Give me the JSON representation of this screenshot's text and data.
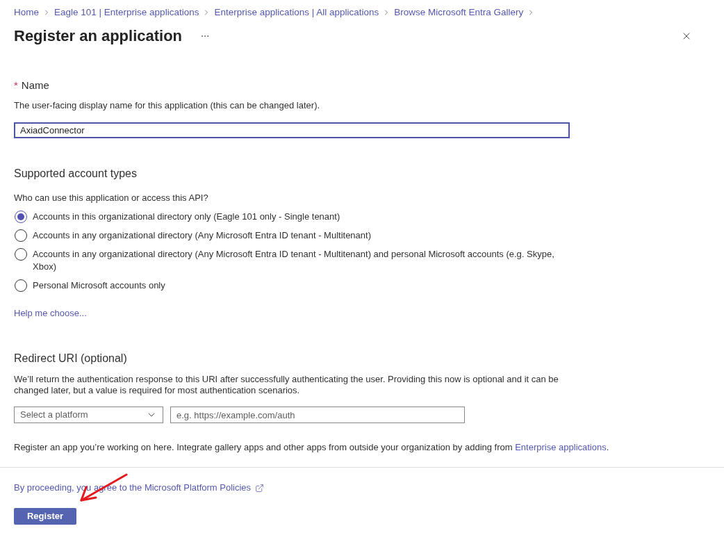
{
  "breadcrumb": [
    {
      "label": "Home"
    },
    {
      "label": "Eagle 101 | Enterprise applications"
    },
    {
      "label": "Enterprise applications | All applications"
    },
    {
      "label": "Browse Microsoft Entra Gallery"
    }
  ],
  "title": "Register an application",
  "name_field": {
    "required_mark": "*",
    "label": "Name",
    "description": "The user-facing display name for this application (this can be changed later).",
    "value": "AxiadConnector",
    "focused": true
  },
  "account_types": {
    "heading": "Supported account types",
    "question": "Who can use this application or access this API?",
    "options": [
      {
        "label": "Accounts in this organizational directory only (Eagle 101 only - Single tenant)",
        "selected": true
      },
      {
        "label": "Accounts in any organizational directory (Any Microsoft Entra ID tenant - Multitenant)",
        "selected": false
      },
      {
        "label": "Accounts in any organizational directory (Any Microsoft Entra ID tenant - Multitenant) and personal Microsoft accounts (e.g. Skype, Xbox)",
        "selected": false
      },
      {
        "label": "Personal Microsoft accounts only",
        "selected": false
      }
    ],
    "help_link": "Help me choose..."
  },
  "redirect_uri": {
    "heading": "Redirect URI (optional)",
    "description": "We’ll return the authentication response to this URI after successfully authenticating the user. Providing this now is optional and it can be changed later, but a value is required for most authentication scenarios.",
    "platform_select": {
      "placeholder": "Select a platform"
    },
    "uri_field": {
      "placeholder": "e.g. https://example.com/auth"
    }
  },
  "note": {
    "text": "Register an app you’re working on here. Integrate gallery apps and other apps from outside your organization by adding from ",
    "link": "Enterprise applications",
    "end": "."
  },
  "policy_link": "By proceeding, you agree to the Microsoft Platform Policies",
  "register_button": "Register"
}
